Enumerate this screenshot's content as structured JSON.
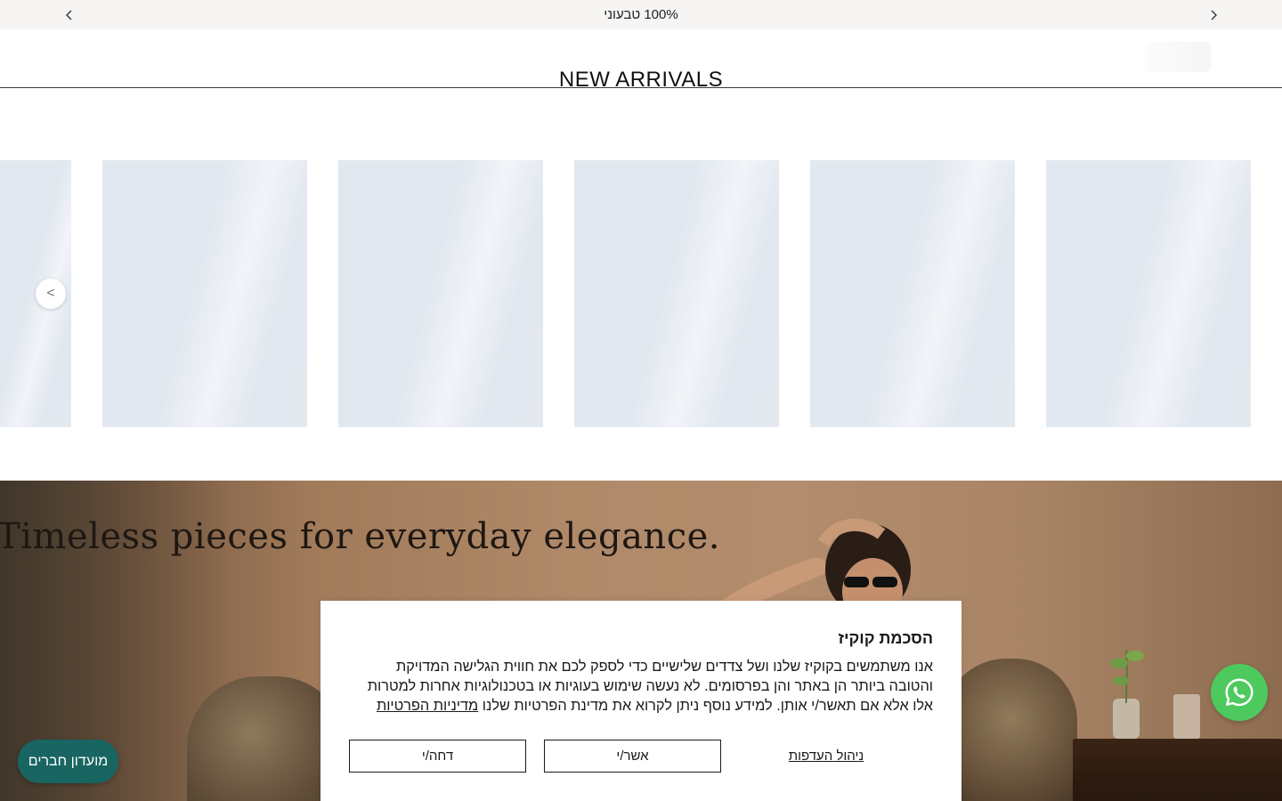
{
  "announcement": {
    "text": "100% טבעוני",
    "prev_icon": "chevron-left-icon",
    "next_icon": "chevron-right-icon"
  },
  "header": {
    "section_title": "NEW ARRIVALS"
  },
  "carousel": {
    "prev_button_label": "<",
    "product_count_visible": 6
  },
  "hero": {
    "tagline": "Timeless pieces for everyday elegance."
  },
  "cookie_banner": {
    "title": "הסכמת קוקיז",
    "body": "אנו משתמשים בקוקיז שלנו ושל צדדים שלישיים כדי לספק לכם את חווית הגלישה המדויקת והטובה ביותר הן באתר והן בפרסומים. לא נעשה שימוש בעוגיות או בטכנולוגיות אחרות למטרות אלו אלא אם תאשר/י אותן. למידע נוסף ניתן לקרוא את מדינת הפרטיות שלנו ",
    "privacy_link": "מדיניות הפרטיות",
    "manage_label": "ניהול העדפות",
    "accept_label": "אשר/י",
    "reject_label": "דחה/י"
  },
  "members_club": {
    "label": "מועדון חברים"
  },
  "whatsapp": {
    "icon": "whatsapp-icon",
    "color": "#4dc95d"
  },
  "colors": {
    "announcement_bg": "#f6f5f3",
    "club_bg": "#186561",
    "placeholder": "#e2e8f0"
  }
}
